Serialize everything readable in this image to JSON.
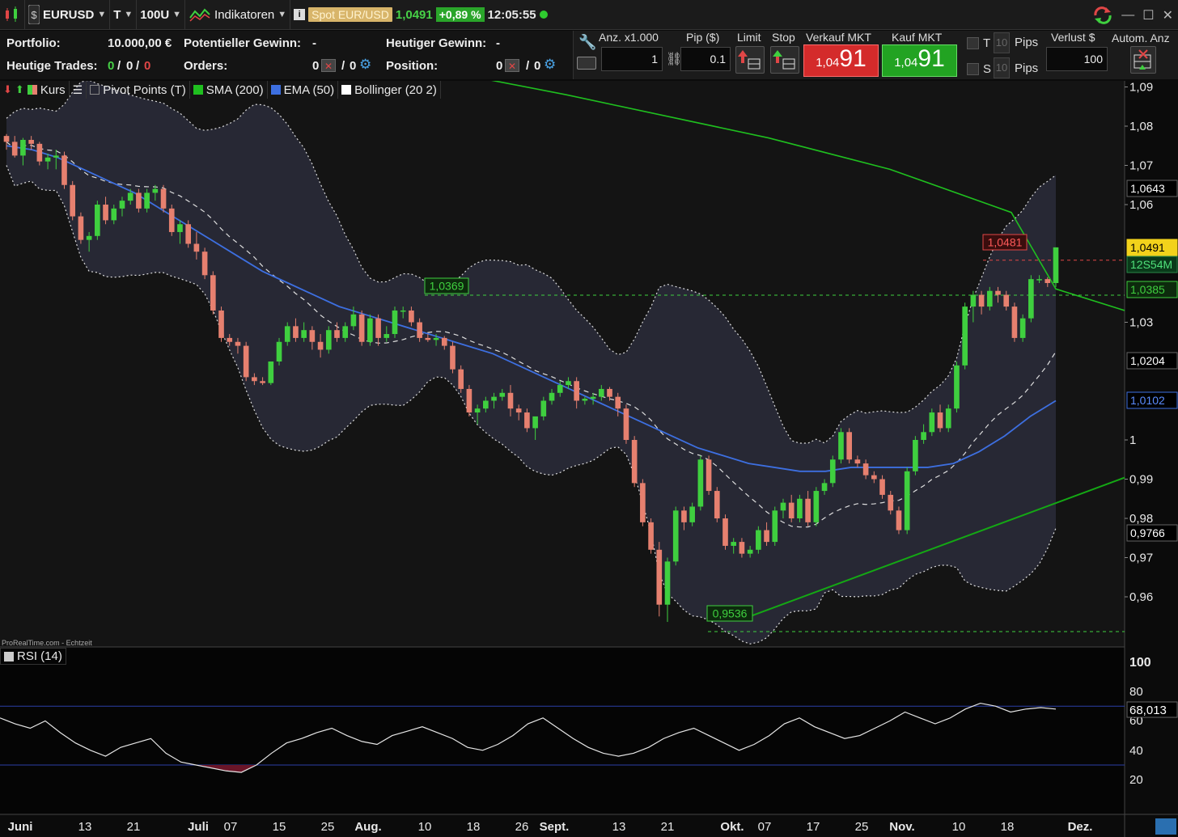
{
  "toolbar": {
    "symbol": "EURUSD",
    "timeframe": "T",
    "units": "100U",
    "indicators_label": "Indikatoren",
    "spot_label": "Spot EUR/USD",
    "last_price": "1,0491",
    "change_pct": "+0,89 %",
    "time": "12:05:55"
  },
  "info": {
    "portfolio_label": "Portfolio:",
    "portfolio_value": "10.000,00 €",
    "potential_gain_label": "Potentieller Gewinn:",
    "potential_gain_value": "-",
    "today_gain_label": "Heutiger Gewinn:",
    "today_gain_value": "-",
    "trades_label": "Heutige Trades:",
    "trades_a": "0",
    "trades_b": "0",
    "trades_c": "0",
    "orders_label": "Orders:",
    "orders_a": "0",
    "orders_b": "0",
    "position_label": "Position:",
    "position_a": "0",
    "position_b": "0"
  },
  "order": {
    "qty_label": "Anz. x1.000",
    "qty_value": "1",
    "pip_label": "Pip ($)",
    "pip_value": "0.1",
    "limit_label": "Limit",
    "stop_label": "Stop",
    "sell_label": "Verkauf MKT",
    "buy_label": "Kauf MKT",
    "sell_small": "1,04",
    "sell_big": "91",
    "buy_small": "1,04",
    "buy_big": "91",
    "t_label": "T",
    "s_label": "S",
    "t_pips": "10",
    "s_pips": "10",
    "pips_label": "Pips",
    "loss_label": "Verlust $",
    "loss_value": "100",
    "auto_label": "Autom. Anz"
  },
  "legend": {
    "kurs": "Kurs",
    "pivot": "Pivot Points (T)",
    "sma": "SMA (200)",
    "ema": "EMA (50)",
    "bollinger": "Bollinger (20 2)",
    "rsi": "RSI (14)",
    "source": "ProRealTime.com - Echtzeit"
  },
  "colors": {
    "up": "#3fcf3f",
    "down": "#e6806f",
    "sma": "#1fbf1f",
    "ema": "#3d6fe0",
    "band_fill": "#2a2c3a",
    "trendline": "#14a814"
  },
  "chart_data": {
    "type": "candlestick",
    "y_ticks": [
      "1,09",
      "1,08",
      "1,07",
      "1,06",
      "1,03",
      "1",
      "0,99",
      "0,98",
      "0,97",
      "0,96"
    ],
    "right_labels": {
      "bb_upper": "1,0643",
      "last": "1,0491",
      "countdown": "12S54M",
      "level": "1,0385",
      "bb_mid": "1,0204",
      "ema": "1,0102",
      "bb_lower": "0,9766"
    },
    "annotations": {
      "resistance": "1,0369",
      "support_low": "0,9536",
      "recent_high": "1,0481"
    },
    "x_labels": [
      "Juni",
      "13",
      "21",
      "Juli",
      "07",
      "15",
      "25",
      "Aug.",
      "10",
      "18",
      "26",
      "Sept.",
      "13",
      "21",
      "Okt.",
      "07",
      "17",
      "25",
      "Nov.",
      "10",
      "18",
      "Dez."
    ],
    "ohlc": [
      [
        1.0775,
        1.078,
        1.074,
        1.076
      ],
      [
        1.076,
        1.0775,
        1.072,
        1.0725
      ],
      [
        1.0725,
        1.077,
        1.07,
        1.0765
      ],
      [
        1.0765,
        1.0775,
        1.074,
        1.0755
      ],
      [
        1.0755,
        1.076,
        1.07,
        1.071
      ],
      [
        1.071,
        1.073,
        1.069,
        1.072
      ],
      [
        1.072,
        1.074,
        1.069,
        1.0725
      ],
      [
        1.0725,
        1.0735,
        1.064,
        1.065
      ],
      [
        1.065,
        1.066,
        1.056,
        1.057
      ],
      [
        1.057,
        1.058,
        1.05,
        1.051
      ],
      [
        1.051,
        1.053,
        1.048,
        1.052
      ],
      [
        1.052,
        1.061,
        1.051,
        1.06
      ],
      [
        1.06,
        1.062,
        1.055,
        1.056
      ],
      [
        1.056,
        1.06,
        1.055,
        1.059
      ],
      [
        1.059,
        1.062,
        1.057,
        1.061
      ],
      [
        1.061,
        1.064,
        1.06,
        1.063
      ],
      [
        1.063,
        1.064,
        1.058,
        1.059
      ],
      [
        1.059,
        1.064,
        1.058,
        1.063
      ],
      [
        1.063,
        1.065,
        1.061,
        1.064
      ],
      [
        1.064,
        1.065,
        1.058,
        1.059
      ],
      [
        1.059,
        1.06,
        1.052,
        1.053
      ],
      [
        1.053,
        1.056,
        1.05,
        1.055
      ],
      [
        1.055,
        1.056,
        1.049,
        1.05
      ],
      [
        1.05,
        1.053,
        1.046,
        1.048
      ],
      [
        1.048,
        1.049,
        1.041,
        1.042
      ],
      [
        1.042,
        1.043,
        1.032,
        1.033
      ],
      [
        1.033,
        1.034,
        1.025,
        1.026
      ],
      [
        1.026,
        1.027,
        1.024,
        1.025
      ],
      [
        1.025,
        1.026,
        1.022,
        1.024
      ],
      [
        1.024,
        1.025,
        1.015,
        1.016
      ],
      [
        1.016,
        1.017,
        1.014,
        1.015
      ],
      [
        1.015,
        1.016,
        1.014,
        1.0145
      ],
      [
        1.0145,
        1.02,
        1.014,
        1.02
      ],
      [
        1.02,
        1.026,
        1.019,
        1.025
      ],
      [
        1.025,
        1.03,
        1.024,
        1.029
      ],
      [
        1.029,
        1.031,
        1.025,
        1.026
      ],
      [
        1.026,
        1.03,
        1.025,
        1.028
      ],
      [
        1.028,
        1.029,
        1.023,
        1.025
      ],
      [
        1.025,
        1.027,
        1.021,
        1.023
      ],
      [
        1.023,
        1.029,
        1.022,
        1.028
      ],
      [
        1.028,
        1.03,
        1.025,
        1.026
      ],
      [
        1.026,
        1.03,
        1.025,
        1.029
      ],
      [
        1.029,
        1.034,
        1.028,
        1.032
      ],
      [
        1.032,
        1.033,
        1.024,
        1.025
      ],
      [
        1.025,
        1.032,
        1.024,
        1.031
      ],
      [
        1.031,
        1.032,
        1.024,
        1.026
      ],
      [
        1.026,
        1.029,
        1.025,
        1.027
      ],
      [
        1.027,
        1.034,
        1.026,
        1.033
      ],
      [
        1.033,
        1.034,
        1.031,
        1.033
      ],
      [
        1.033,
        1.034,
        1.029,
        1.03
      ],
      [
        1.03,
        1.031,
        1.025,
        1.026
      ],
      [
        1.026,
        1.027,
        1.025,
        1.0255
      ],
      [
        1.0255,
        1.027,
        1.024,
        1.026
      ],
      [
        1.026,
        1.0265,
        1.023,
        1.024
      ],
      [
        1.024,
        1.025,
        1.017,
        1.018
      ],
      [
        1.018,
        1.019,
        1.012,
        1.013
      ],
      [
        1.013,
        1.014,
        1.006,
        1.007
      ],
      [
        1.007,
        1.009,
        1.004,
        1.008
      ],
      [
        1.008,
        1.011,
        1.007,
        1.01
      ],
      [
        1.01,
        1.012,
        1.008,
        1.011
      ],
      [
        1.011,
        1.013,
        1.01,
        1.012
      ],
      [
        1.012,
        1.014,
        1.006,
        1.008
      ],
      [
        1.008,
        1.009,
        1.005,
        1.007
      ],
      [
        1.007,
        1.008,
        1.002,
        1.003
      ],
      [
        1.003,
        1.005,
        1.0,
        1.006
      ],
      [
        1.006,
        1.011,
        1.005,
        1.01
      ],
      [
        1.01,
        1.013,
        1.009,
        1.012
      ],
      [
        1.012,
        1.015,
        1.011,
        1.014
      ],
      [
        1.014,
        1.016,
        1.013,
        1.015
      ],
      [
        1.015,
        1.016,
        1.008,
        1.01
      ],
      [
        1.01,
        1.011,
        1.009,
        1.0105
      ],
      [
        1.0105,
        1.012,
        1.009,
        1.011
      ],
      [
        1.011,
        1.014,
        1.01,
        1.013
      ],
      [
        1.013,
        1.0135,
        1.01,
        1.011
      ],
      [
        1.011,
        1.012,
        1.006,
        1.008
      ],
      [
        1.008,
        1.009,
        0.999,
        1.0
      ],
      [
        1.0,
        1.001,
        0.988,
        0.989
      ],
      [
        0.989,
        0.99,
        0.978,
        0.979
      ],
      [
        0.979,
        0.98,
        0.971,
        0.972
      ],
      [
        0.972,
        0.974,
        0.955,
        0.958
      ],
      [
        0.958,
        0.97,
        0.9536,
        0.969
      ],
      [
        0.969,
        0.983,
        0.968,
        0.982
      ],
      [
        0.982,
        0.983,
        0.977,
        0.979
      ],
      [
        0.979,
        0.984,
        0.978,
        0.983
      ],
      [
        0.983,
        0.996,
        0.982,
        0.995
      ],
      [
        0.995,
        0.996,
        0.986,
        0.987
      ],
      [
        0.987,
        0.988,
        0.979,
        0.98
      ],
      [
        0.98,
        0.981,
        0.972,
        0.973
      ],
      [
        0.973,
        0.975,
        0.971,
        0.974
      ],
      [
        0.974,
        0.975,
        0.97,
        0.971
      ],
      [
        0.971,
        0.973,
        0.97,
        0.972
      ],
      [
        0.972,
        0.978,
        0.971,
        0.977
      ],
      [
        0.977,
        0.979,
        0.973,
        0.974
      ],
      [
        0.974,
        0.983,
        0.973,
        0.982
      ],
      [
        0.982,
        0.985,
        0.98,
        0.984
      ],
      [
        0.984,
        0.986,
        0.979,
        0.98
      ],
      [
        0.98,
        0.986,
        0.979,
        0.985
      ],
      [
        0.985,
        0.987,
        0.978,
        0.979
      ],
      [
        0.979,
        0.988,
        0.978,
        0.987
      ],
      [
        0.987,
        0.99,
        0.986,
        0.989
      ],
      [
        0.989,
        0.996,
        0.988,
        0.995
      ],
      [
        0.995,
        1.003,
        0.994,
        1.002
      ],
      [
        1.002,
        1.003,
        0.994,
        0.995
      ],
      [
        0.995,
        0.996,
        0.993,
        0.994
      ],
      [
        0.994,
        0.995,
        0.99,
        0.991
      ],
      [
        0.991,
        0.992,
        0.989,
        0.99
      ],
      [
        0.99,
        0.991,
        0.985,
        0.986
      ],
      [
        0.986,
        0.987,
        0.981,
        0.982
      ],
      [
        0.982,
        0.983,
        0.976,
        0.977
      ],
      [
        0.977,
        0.993,
        0.976,
        0.992
      ],
      [
        0.992,
        1.001,
        0.991,
        1.0
      ],
      [
        1.0,
        1.004,
        0.999,
        1.002
      ],
      [
        1.002,
        1.008,
        1.001,
        1.007
      ],
      [
        1.007,
        1.009,
        1.002,
        1.003
      ],
      [
        1.003,
        1.009,
        1.002,
        1.008
      ],
      [
        1.008,
        1.02,
        1.007,
        1.019
      ],
      [
        1.019,
        1.035,
        1.018,
        1.034
      ],
      [
        1.034,
        1.038,
        1.03,
        1.037
      ],
      [
        1.037,
        1.038,
        1.032,
        1.034
      ],
      [
        1.034,
        1.039,
        1.033,
        1.038
      ],
      [
        1.038,
        1.039,
        1.035,
        1.037
      ],
      [
        1.037,
        1.038,
        1.033,
        1.034
      ],
      [
        1.034,
        1.035,
        1.025,
        1.026
      ],
      [
        1.026,
        1.032,
        1.025,
        1.031
      ],
      [
        1.031,
        1.042,
        1.03,
        1.041
      ],
      [
        1.041,
        1.042,
        1.04,
        1.041
      ],
      [
        1.041,
        1.0415,
        1.039,
        1.04
      ],
      [
        1.04,
        1.0481,
        1.039,
        1.0491
      ]
    ],
    "sma200": [
      [
        0,
        1.112
      ],
      [
        200,
        1.105
      ],
      [
        450,
        1.098
      ],
      [
        700,
        1.088
      ],
      [
        950,
        1.077
      ],
      [
        1100,
        1.069
      ],
      [
        1250,
        1.058
      ],
      [
        1305,
        1.0385
      ],
      [
        1390,
        1.033
      ]
    ],
    "ema50": [
      1.075,
      1.074,
      1.072,
      1.069,
      1.066,
      1.063,
      1.059,
      1.055,
      1.051,
      1.047,
      1.043,
      1.04,
      1.037,
      1.034,
      1.032,
      1.03,
      1.028,
      1.026,
      1.024,
      1.022,
      1.019,
      1.016,
      1.013,
      1.01,
      1.007,
      1.004,
      1.001,
      0.998,
      0.996,
      0.994,
      0.993,
      0.992,
      0.992,
      0.993,
      0.993,
      0.993,
      0.993,
      0.994,
      0.997,
      1.001,
      1.006,
      1.01
    ],
    "rsi": [
      62,
      58,
      55,
      60,
      52,
      45,
      40,
      36,
      42,
      45,
      48,
      38,
      32,
      30,
      28,
      26,
      25,
      30,
      38,
      45,
      48,
      52,
      55,
      50,
      46,
      44,
      50,
      53,
      56,
      52,
      48,
      42,
      40,
      44,
      50,
      58,
      62,
      55,
      48,
      42,
      38,
      36,
      38,
      42,
      48,
      52,
      55,
      50,
      45,
      40,
      44,
      50,
      58,
      62,
      56,
      52,
      48,
      50,
      55,
      60,
      66,
      62,
      58,
      62,
      68,
      72,
      70,
      66,
      68,
      69,
      68
    ]
  }
}
